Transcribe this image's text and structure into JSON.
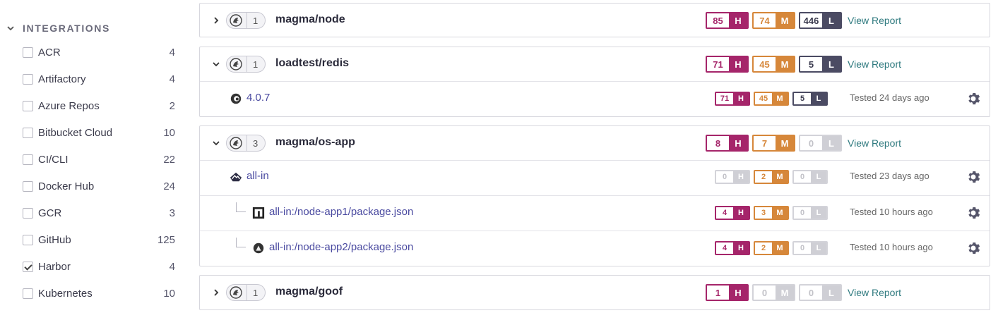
{
  "sidebar": {
    "section_title": "INTEGRATIONS",
    "filters": [
      {
        "label": "ACR",
        "count": "4",
        "checked": false
      },
      {
        "label": "Artifactory",
        "count": "4",
        "checked": false
      },
      {
        "label": "Azure Repos",
        "count": "2",
        "checked": false
      },
      {
        "label": "Bitbucket Cloud",
        "count": "10",
        "checked": false
      },
      {
        "label": "CI/CLI",
        "count": "22",
        "checked": false
      },
      {
        "label": "Docker Hub",
        "count": "24",
        "checked": false
      },
      {
        "label": "GCR",
        "count": "3",
        "checked": false
      },
      {
        "label": "GitHub",
        "count": "125",
        "checked": false
      },
      {
        "label": "Harbor",
        "count": "4",
        "checked": true
      },
      {
        "label": "Kubernetes",
        "count": "10",
        "checked": false
      }
    ]
  },
  "severity_labels": {
    "high": "H",
    "medium": "M",
    "low": "L"
  },
  "colors": {
    "high": "#a5256a",
    "medium": "#d6873a",
    "low": "#4b4b63",
    "zero": "#cfcfd5",
    "link": "#2f7a7f",
    "target_link": "#4a4aa0"
  },
  "projects": [
    {
      "name": "magma/node",
      "target_count": "1",
      "expanded": false,
      "counts": {
        "high": "85",
        "medium": "74",
        "low": "446"
      },
      "view_report": "View Report"
    },
    {
      "name": "loadtest/redis",
      "target_count": "1",
      "expanded": true,
      "counts": {
        "high": "71",
        "medium": "45",
        "low": "5"
      },
      "view_report": "View Report",
      "targets": [
        {
          "name": "4.0.7",
          "icon": "debian-icon",
          "counts": {
            "high": "71",
            "medium": "45",
            "low": "5"
          },
          "tested": "Tested 24 days ago"
        }
      ]
    },
    {
      "name": "magma/os-app",
      "target_count": "3",
      "expanded": true,
      "counts": {
        "high": "8",
        "medium": "7",
        "low": "0"
      },
      "view_report": "View Report",
      "targets": [
        {
          "name": "all-in",
          "icon": "alpine-icon",
          "counts": {
            "high": "0",
            "medium": "2",
            "low": "0"
          },
          "tested": "Tested 23 days ago"
        },
        {
          "name": "all-in:/node-app1/package.json",
          "icon": "npm-icon",
          "counts": {
            "high": "4",
            "medium": "3",
            "low": "0"
          },
          "tested": "Tested 10 hours ago"
        },
        {
          "name": "all-in:/node-app2/package.json",
          "icon": "node-icon",
          "counts": {
            "high": "4",
            "medium": "2",
            "low": "0"
          },
          "tested": "Tested 10 hours ago"
        }
      ]
    },
    {
      "name": "magma/goof",
      "target_count": "1",
      "expanded": false,
      "counts": {
        "high": "1",
        "medium": "0",
        "low": "0"
      },
      "view_report": "View Report"
    }
  ]
}
